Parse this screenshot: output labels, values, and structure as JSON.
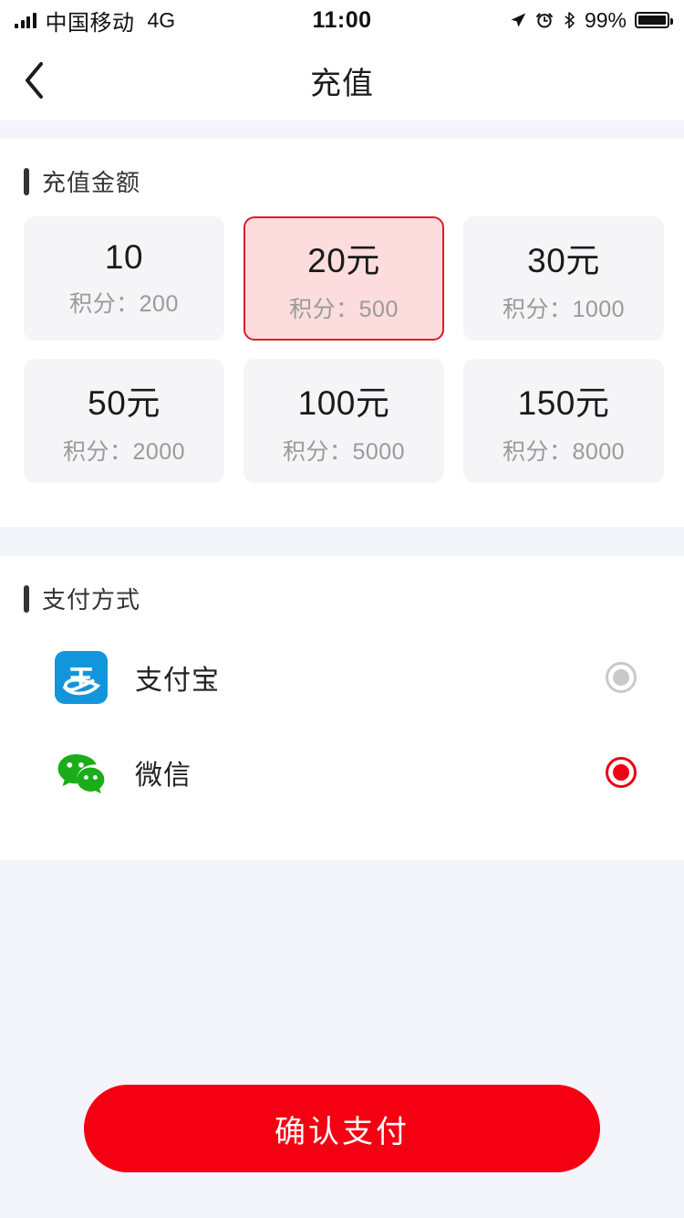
{
  "status_bar": {
    "carrier": "中国移动",
    "network": "4G",
    "time": "11:00",
    "battery_percent": "99%",
    "icons": [
      "signal-bars-icon",
      "location-arrow-icon",
      "alarm-clock-icon",
      "bluetooth-icon",
      "battery-icon"
    ]
  },
  "header": {
    "title": "充值",
    "back_icon": "chevron-left-icon"
  },
  "amount_section": {
    "title": "充值金额",
    "options": [
      {
        "amount": "10",
        "points": "积分：200"
      },
      {
        "amount": "20元",
        "points": "积分：500"
      },
      {
        "amount": "30元",
        "points": "积分：1000"
      },
      {
        "amount": "50元",
        "points": "积分：2000"
      },
      {
        "amount": "100元",
        "points": "积分：5000"
      },
      {
        "amount": "150元",
        "points": "积分：8000"
      }
    ],
    "selected_index": 1
  },
  "payment_section": {
    "title": "支付方式",
    "methods": [
      {
        "name": "支付宝",
        "icon": "alipay-icon",
        "selected": false
      },
      {
        "name": "微信",
        "icon": "wechat-icon",
        "selected": true
      }
    ]
  },
  "footer": {
    "confirm_label": "确认支付"
  },
  "colors": {
    "accent_red": "#f50012",
    "selected_border": "#d81e28",
    "selected_fill": "#fcdcdd",
    "card_bg": "#f5f5f7",
    "page_bg": "#f4f5fa",
    "alipay_blue": "#1296db",
    "wechat_green": "#1aad19"
  }
}
